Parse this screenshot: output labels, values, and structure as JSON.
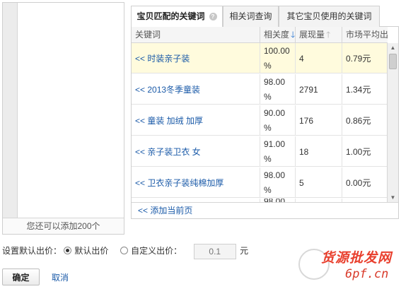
{
  "left_panel": {
    "remaining_text": "您还可以添加200个"
  },
  "tabs": [
    {
      "label": "宝贝匹配的关键词",
      "active": true,
      "help_icon": "help-icon"
    },
    {
      "label": "相关词查询",
      "active": false
    },
    {
      "label": "其它宝贝使用的关键词",
      "active": false
    }
  ],
  "table": {
    "columns": {
      "keyword": "关键词",
      "relevance": "相关度",
      "impressions": "展现量",
      "avg_price": "市场平均出价"
    },
    "sort_icons": {
      "relevance": "arrow-down-icon",
      "impressions": "arrow-up-icon"
    },
    "rows": [
      {
        "keyword": "<< 时装亲子装",
        "relevance": "100.00 %",
        "impressions": "4",
        "avg_price": "0.79元",
        "highlight": true
      },
      {
        "keyword": "<< 2013冬季童装",
        "relevance": "98.00 %",
        "impressions": "2791",
        "avg_price": "1.34元",
        "highlight": false
      },
      {
        "keyword": "<< 童装 加绒 加厚",
        "relevance": "90.00 %",
        "impressions": "176",
        "avg_price": "0.86元",
        "highlight": false
      },
      {
        "keyword": "<< 亲子装卫衣 女",
        "relevance": "91.00 %",
        "impressions": "18",
        "avg_price": "1.00元",
        "highlight": false
      },
      {
        "keyword": "<< 卫衣亲子装纯棉加厚",
        "relevance": "98.00 %",
        "impressions": "5",
        "avg_price": "0.00元",
        "highlight": false
      }
    ],
    "partial_row_relevance": "98.00",
    "add_page_link": "<<  添加当前页"
  },
  "settings": {
    "label": "设置默认出价：",
    "default_option": "默认出价",
    "custom_option": "自定义出价：",
    "selected": "default",
    "price_placeholder": "0.1",
    "unit": "元"
  },
  "buttons": {
    "ok": "确定",
    "cancel": "取消"
  },
  "watermark": {
    "title": "货源批发网",
    "url": "6pf.cn"
  },
  "colors": {
    "link": "#1a5aa8",
    "highlight_row": "#fffbdd",
    "watermark": "#e9402e"
  }
}
